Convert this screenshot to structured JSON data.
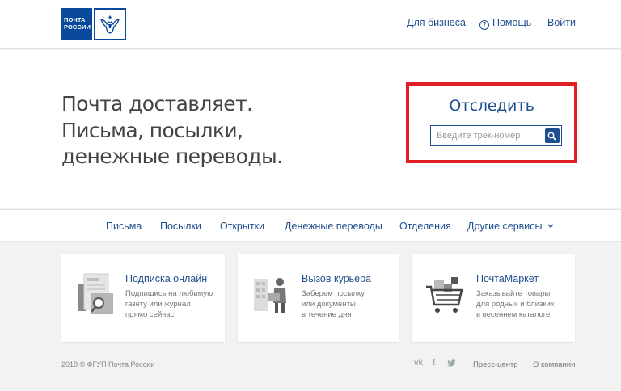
{
  "header": {
    "logo_line1": "ПОЧТА",
    "logo_line2": "РОССИИ",
    "business": "Для бизнеса",
    "help": "Помощь",
    "login": "Войти"
  },
  "hero": {
    "line1": "Почта доставляет.",
    "line2": "Письма, посылки,",
    "line3": "денежные переводы."
  },
  "tracking": {
    "title": "Отследить",
    "placeholder": "Введите трек-номер"
  },
  "nav": {
    "items": [
      "Письма",
      "Посылки",
      "Открытки",
      "Денежные переводы",
      "Отделения",
      "Другие сервисы"
    ]
  },
  "cards": [
    {
      "title": "Подписка онлайн",
      "desc": [
        "Подпишись на любимую",
        "газету или журнал",
        "прямо сейчас"
      ]
    },
    {
      "title": "Вызов курьера",
      "desc": [
        "Заберем посылку",
        "или документы",
        "в течение дня"
      ]
    },
    {
      "title": "ПочтаМаркет",
      "desc": [
        "Заказывайте товары",
        "для родных и близких",
        "в весеннем каталоге"
      ]
    }
  ],
  "footer": {
    "copyright": "2018 © ФГУП Почта России",
    "vk": "vk",
    "fb": "f",
    "press": "Пресс-центр",
    "about": "О компании"
  },
  "colors": {
    "brand_blue": "#0a4a9c",
    "link_blue": "#1f4e8f",
    "highlight_red": "#e11d25"
  }
}
